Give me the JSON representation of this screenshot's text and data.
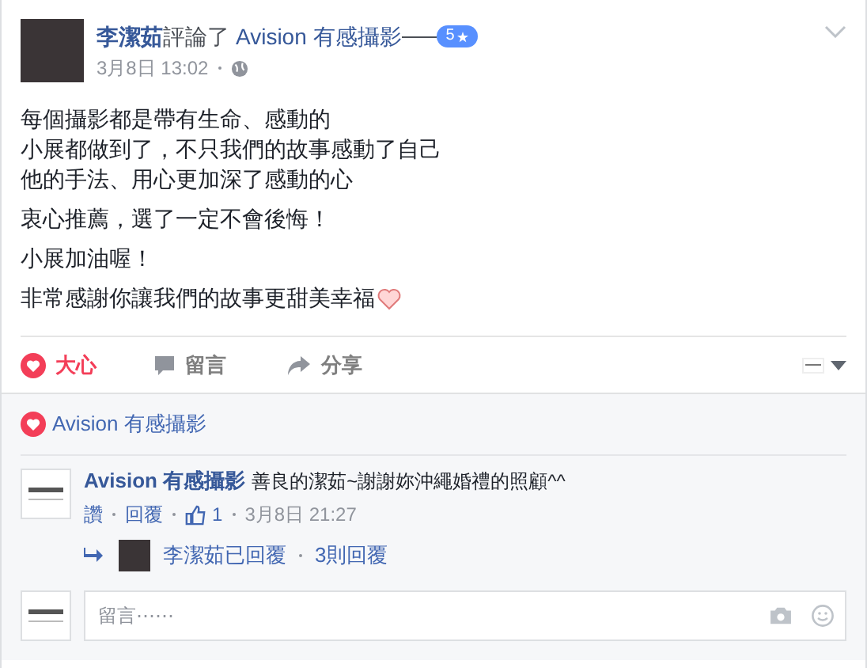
{
  "post": {
    "author": "李潔茹",
    "action": "評論了",
    "page": "Avision 有感攝影",
    "rating": "5",
    "time": "3月8日 13:02",
    "paragraphs": [
      [
        "每個攝影都是帶有生命、感動的",
        "小展都做到了，不只我們的故事感動了自己",
        "他的手法、用心更加深了感動的心"
      ],
      [
        "衷心推薦，選了一定不會後悔！"
      ],
      [
        "小展加油喔！"
      ],
      [
        "非常感謝你讓我們的故事更甜美幸福"
      ]
    ]
  },
  "actions": [
    {
      "kind": "love",
      "label": "大心",
      "selected": true
    },
    {
      "kind": "comment",
      "label": "留言",
      "selected": false
    },
    {
      "kind": "share",
      "label": "分享",
      "selected": false
    }
  ],
  "reactions": {
    "name": "Avision 有感攝影"
  },
  "comment": {
    "author": "Avision 有感攝影",
    "text": "善良的潔茹~謝謝妳沖繩婚禮的照顧^^",
    "like": "讚",
    "reply": "回覆",
    "likes": "1",
    "time": "3月8日 21:27",
    "replied_by": "李潔茹已回覆",
    "reply_count": "3則回覆"
  },
  "comment_box": {
    "placeholder": "留言⋯⋯"
  }
}
